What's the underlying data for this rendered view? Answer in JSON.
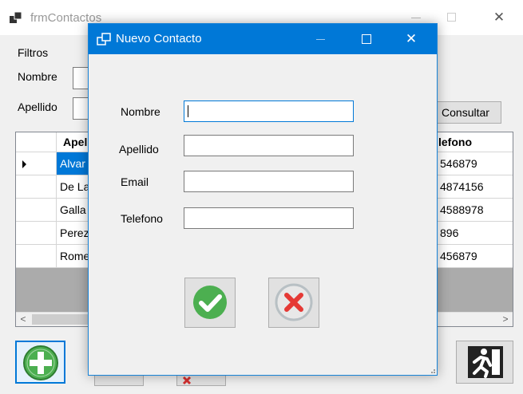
{
  "parent": {
    "title": "frmContactos",
    "filters_label": "Filtros",
    "nombre_label": "Nombre",
    "apellido_label": "Apellido",
    "consultar_label": "Consultar",
    "grid": {
      "headers": [
        "Apel",
        "lefono"
      ],
      "rows": [
        {
          "apellido": "Alvar",
          "telefono": "546879"
        },
        {
          "apellido": "De La",
          "telefono": "4874156"
        },
        {
          "apellido": "Galla",
          "telefono": "4588978"
        },
        {
          "apellido": "Perez",
          "telefono": "896"
        },
        {
          "apellido": "Rome",
          "telefono": "456879"
        }
      ]
    }
  },
  "dialog": {
    "title": "Nuevo Contacto",
    "fields": {
      "nombre": {
        "label": "Nombre",
        "value": ""
      },
      "apellido": {
        "label": "Apellido",
        "value": ""
      },
      "email": {
        "label": "Email",
        "value": ""
      },
      "telefono": {
        "label": "Telefono",
        "value": ""
      }
    }
  },
  "icons": {
    "app": "app-window-icon",
    "accept": "green-check-icon",
    "cancel": "red-x-icon",
    "add": "green-plus-icon",
    "exit": "exit-running-man-icon"
  },
  "colors": {
    "accent": "#0078d7",
    "accept_green": "#4caf50",
    "cancel_red": "#e53935"
  }
}
